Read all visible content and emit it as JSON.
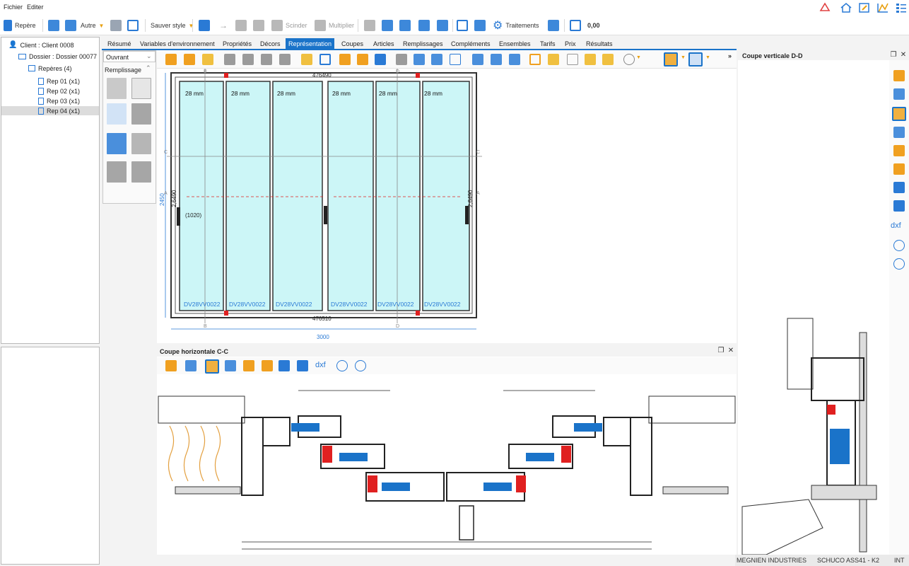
{
  "menu": {
    "file": "Fichier",
    "edit": "Editer"
  },
  "toolbar": {
    "repere": "Repère",
    "autre": "Autre",
    "sauver_style": "Sauver style",
    "scinder": "Scinder",
    "multiplier": "Multiplier",
    "traitements": "Traitements",
    "amount": "0,00"
  },
  "tree": {
    "client": "Client : Client 0008",
    "dossier": "Dossier : Dossier 00077",
    "reperes": "Repères (4)",
    "items": [
      "Rep 01 (x1)",
      "Rep 02 (x1)",
      "Rep 03 (x1)",
      "Rep 04 (x1)"
    ]
  },
  "tabs": [
    "Résumé",
    "Variables d'environnement",
    "Propriétés",
    "Décors",
    "Représentation",
    "Coupes",
    "Articles",
    "Remplissages",
    "Compléments",
    "Ensembles",
    "Tarifs",
    "Prix",
    "Résultats"
  ],
  "active_tab": "Représentation",
  "palette": {
    "dropdown": "Ouvrant",
    "section": "Remplissage"
  },
  "drawing": {
    "glass_labels_top": [
      "28 mm",
      "28 mm",
      "28 mm",
      "28 mm",
      "28 mm",
      "28 mm"
    ],
    "glass_labels_bottom": [
      "DV28VV0022",
      "DV28VV0022",
      "DV28VV0022",
      "DV28VV0022",
      "DV28VV0022",
      "DV28VV0022"
    ],
    "dim_top": "476490",
    "dim_bottom": "476510",
    "dim_width": "3000",
    "dim_height": "2450",
    "dim_left_inner": "2,6490",
    "dim_right_inner": "2,6490",
    "handle_label": "(1020)",
    "section_marks": [
      "B",
      "D",
      "C",
      "C",
      "A",
      "A",
      "B",
      "D"
    ]
  },
  "panel_horizontal": {
    "title": "Coupe horizontale C-C"
  },
  "panel_vertical": {
    "title": "Coupe verticale D-D"
  },
  "status": {
    "company": "MEGNIEN INDUSTRIES",
    "system": "SCHUCO ASS41 - K2",
    "lang": "INT"
  },
  "colors": {
    "accent": "#1a73c9",
    "glass": "#ccf6f7",
    "profile_red": "#e02020"
  }
}
